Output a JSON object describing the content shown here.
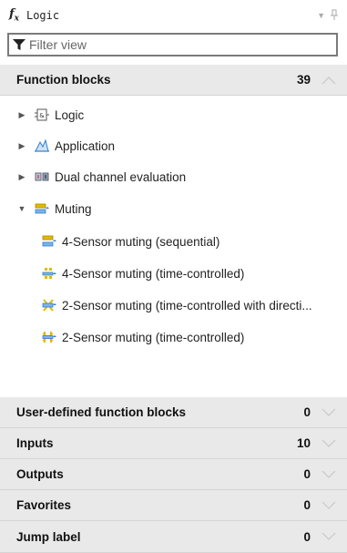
{
  "titlebar": {
    "title": "Logic"
  },
  "filter": {
    "placeholder": "Filter view",
    "value": ""
  },
  "function_blocks": {
    "label": "Function blocks",
    "count": "39",
    "groups": [
      {
        "label": "Logic",
        "icon": "logic-block-icon",
        "expanded": false
      },
      {
        "label": "Application",
        "icon": "application-icon",
        "expanded": false
      },
      {
        "label": "Dual channel evaluation",
        "icon": "dual-channel-icon",
        "expanded": false
      },
      {
        "label": "Muting",
        "icon": "muting-icon",
        "expanded": true
      }
    ],
    "muting_items": [
      {
        "label": "4-Sensor muting (sequential)",
        "icon": "muting-sequential-icon"
      },
      {
        "label": "4-Sensor muting (time-controlled)",
        "icon": "muting-time-controlled-icon"
      },
      {
        "label": "2-Sensor muting (time-controlled with directi...",
        "icon": "muting-directional-icon"
      },
      {
        "label": "2-Sensor muting (time-controlled)",
        "icon": "muting-two-sensor-icon"
      }
    ]
  },
  "sections": [
    {
      "label": "User-defined function blocks",
      "count": "0"
    },
    {
      "label": "Inputs",
      "count": "10"
    },
    {
      "label": "Outputs",
      "count": "0"
    },
    {
      "label": "Favorites",
      "count": "0"
    },
    {
      "label": "Jump label",
      "count": "0"
    }
  ],
  "colors": {
    "header_bg": "#e9e9e9",
    "divider": "#d4d4d4",
    "icon_blue": "#2f7fd0",
    "icon_yellow": "#e6b800"
  }
}
